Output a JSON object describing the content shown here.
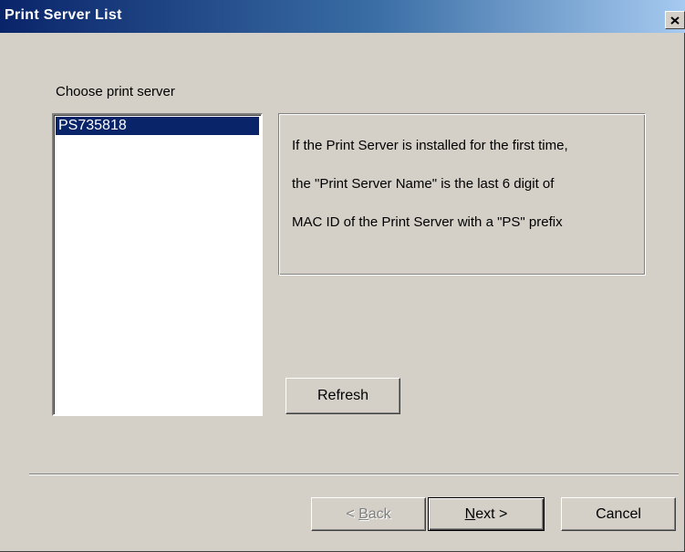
{
  "window": {
    "title": "Print Server List",
    "close_icon": "close-icon"
  },
  "form": {
    "choose_label": "Choose print server",
    "servers": [
      {
        "name": "PS735818",
        "selected": true
      }
    ],
    "info": {
      "line1": "If the Print Server is installed for the first time,",
      "line2": "the \"Print Server Name\" is the last 6 digit of",
      "line3": "MAC ID of the Print Server with a \"PS\" prefix"
    },
    "refresh_label": "Refresh"
  },
  "footer": {
    "back_prefix": "< ",
    "back_mnemonic": "B",
    "back_rest": "ack",
    "back_enabled": false,
    "next_mnemonic": "N",
    "next_rest": "ext >",
    "cancel_label": "Cancel"
  },
  "colors": {
    "title_bar_start": "#0a246a",
    "title_bar_end": "#a6caf0",
    "dialog_bg": "#d4d0c8",
    "selection_bg": "#0a246a"
  }
}
